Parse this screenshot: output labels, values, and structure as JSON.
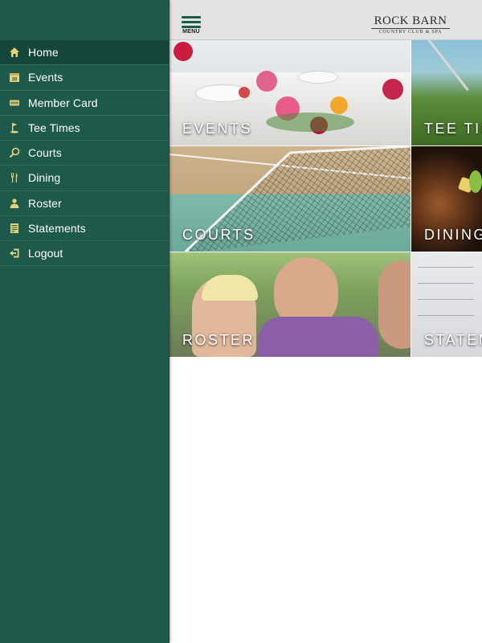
{
  "header": {
    "menu_label": "MENU",
    "logo_main": "ROCK BARN",
    "logo_sub": "COUNTRY CLUB & SPA"
  },
  "sidebar": {
    "items": [
      {
        "label": "Home",
        "icon": "home-icon"
      },
      {
        "label": "Events",
        "icon": "calendar-icon",
        "icon_text": "30"
      },
      {
        "label": "Member Card",
        "icon": "member-card-icon"
      },
      {
        "label": "Tee Times",
        "icon": "golf-flag-icon"
      },
      {
        "label": "Courts",
        "icon": "tennis-racket-icon"
      },
      {
        "label": "Dining",
        "icon": "fork-knife-icon"
      },
      {
        "label": "Roster",
        "icon": "roster-person-icon"
      },
      {
        "label": "Statements",
        "icon": "statement-document-icon"
      },
      {
        "label": "Logout",
        "icon": "logout-icon"
      }
    ]
  },
  "tiles": [
    {
      "label": "EVENTS"
    },
    {
      "label": "TEE TIM"
    },
    {
      "label": "COURTS"
    },
    {
      "label": "DINING"
    },
    {
      "label": "ROSTER"
    },
    {
      "label": "STATEM"
    }
  ],
  "colors": {
    "sidebar_bg": "#1d5a4c",
    "sidebar_active": "#154639",
    "icon_yellow": "#e6d27a",
    "header_bg": "#e3e3e3"
  }
}
